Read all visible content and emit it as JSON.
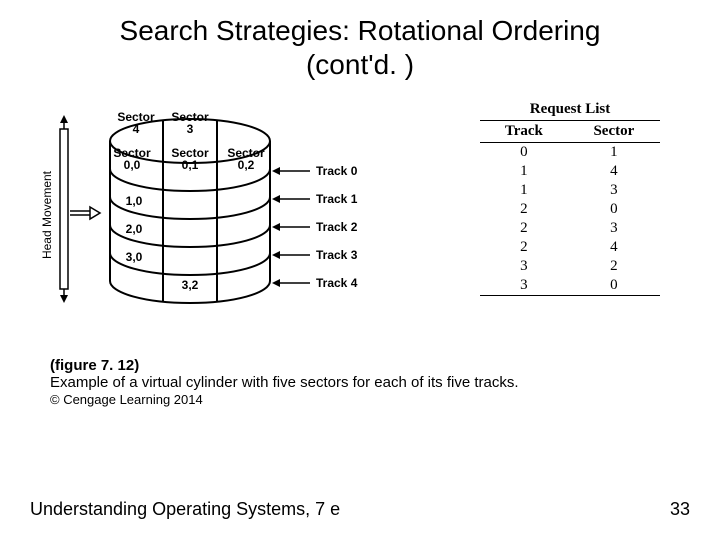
{
  "title_line1": "Search Strategies: Rotational Ordering",
  "title_line2": "(cont'd. )",
  "head_movement": "Head Movement",
  "sector_labels": {
    "s4": "Sector\n4",
    "s3": "Sector\n3",
    "s00": "Sector\n0,0",
    "s01": "Sector\n0,1",
    "s02": "Sector\n0,2"
  },
  "row_labels": [
    "1,0",
    "2,0",
    "3,0",
    "3,2"
  ],
  "track_labels": [
    "Track 0",
    "Track 1",
    "Track 2",
    "Track 3",
    "Track 4"
  ],
  "request_list": {
    "title": "Request List",
    "heads": [
      "Track",
      "Sector"
    ],
    "rows": [
      [
        "0",
        "1"
      ],
      [
        "1",
        "4"
      ],
      [
        "1",
        "3"
      ],
      [
        "2",
        "0"
      ],
      [
        "2",
        "3"
      ],
      [
        "2",
        "4"
      ],
      [
        "3",
        "2"
      ],
      [
        "3",
        "0"
      ]
    ]
  },
  "caption": {
    "fig": "(figure 7. 12)",
    "desc": "Example of a virtual cylinder with five sectors for each of its five tracks.",
    "copyright": "© Cengage Learning 2014"
  },
  "footer_left": "Understanding Operating Systems, 7 e",
  "footer_right": "33"
}
